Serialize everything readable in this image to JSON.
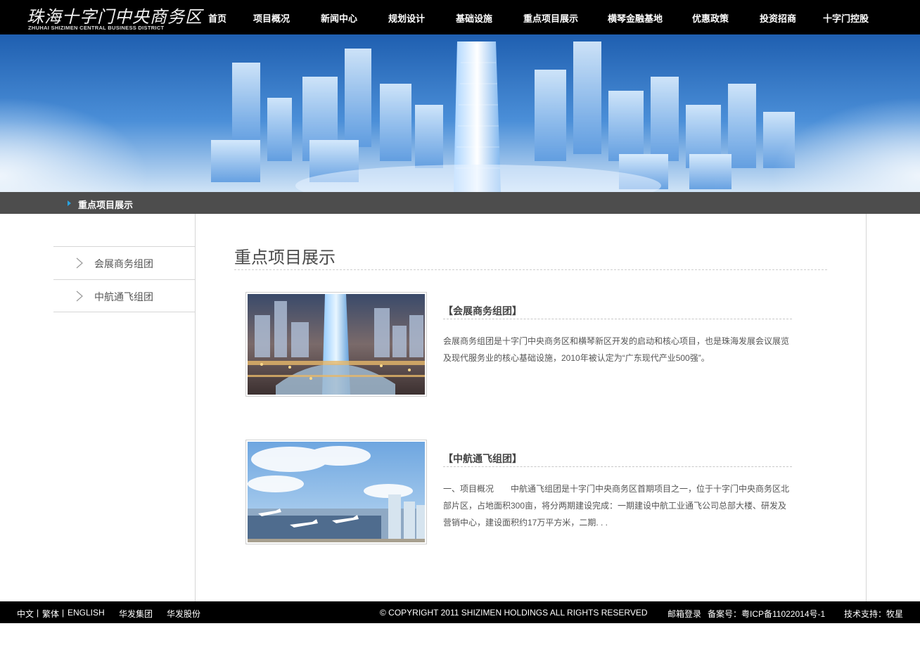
{
  "logo": {
    "cn": "珠海十字门中央商务区",
    "en": "ZHUHAI SHIZIMEN CENTRAL BUSINESS DISTRICT"
  },
  "nav": [
    {
      "label": "首页"
    },
    {
      "label": "项目概况"
    },
    {
      "label": "新闻中心"
    },
    {
      "label": "规划设计"
    },
    {
      "label": "基础设施"
    },
    {
      "label": "重点项目展示"
    },
    {
      "label": "横琴金融基地"
    },
    {
      "label": "优惠政策"
    },
    {
      "label": "投资招商"
    },
    {
      "label": "十字门控股"
    }
  ],
  "breadcrumb": {
    "current": "重点项目展示"
  },
  "sidebar": {
    "items": [
      {
        "label": "会展商务组团"
      },
      {
        "label": "中航通飞组团"
      }
    ]
  },
  "main": {
    "title": "重点项目展示",
    "projects": [
      {
        "title": "【会展商务组团】",
        "desc": "会展商务组团是十字门中央商务区和横琴新区开发的启动和核心项目，也是珠海发展会议展览及现代服务业的核心基础设施，2010年被认定为“广东现代产业500强”。"
      },
      {
        "title": "【中航通飞组团】",
        "desc": "一、项目概况　　中航通飞组团是十字门中央商务区首期项目之一，位于十字门中央商务区北部片区，占地面积300亩，将分两期建设完成：一期建设中航工业通飞公司总部大楼、研发及营销中心，建设面积约17万平方米，二期. . ."
      }
    ]
  },
  "footer": {
    "lang_zh": "中文",
    "sep1": "|",
    "lang_tw": "繁体",
    "sep2": "|",
    "lang_en": "ENGLISH",
    "link1": "华发集团",
    "link2": "华发股份",
    "copyright": "© COPYRIGHT 2011 SHIZIMEN HOLDINGS ALL RIGHTS RESERVED",
    "mail": "邮箱登录",
    "icp": "备案号：粤ICP备11022014号-1",
    "support": "技术支持：牧星"
  },
  "colors": {
    "header_bg": "#000000",
    "crumb_bg": "#4d4d4d",
    "crumb_arrow": "#29a3e0",
    "banner_blue": "#2f7fd0"
  }
}
